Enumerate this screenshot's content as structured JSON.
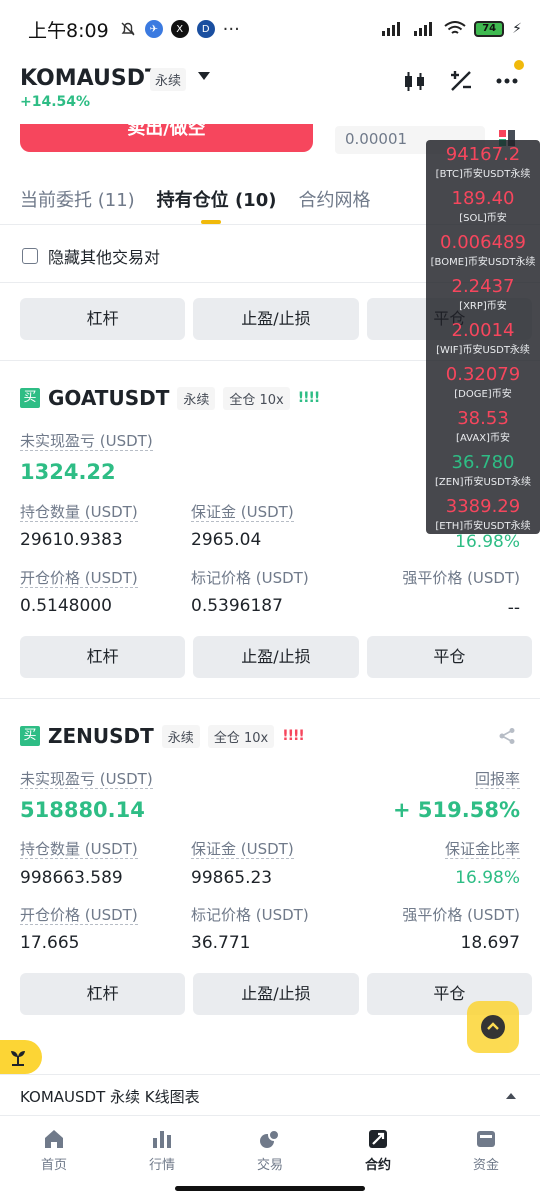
{
  "status": {
    "time": "上午8:09",
    "battery": "74"
  },
  "header": {
    "pair": "KOMAUSDT",
    "contract_type": "永续",
    "change": "+14.54%"
  },
  "order": {
    "sell_label": "卖出/做空",
    "qty_placeholder": "0.00001"
  },
  "tabs": [
    {
      "label": "当前委托 (11)"
    },
    {
      "label": "持有仓位 (10)"
    },
    {
      "label": "合约网格"
    }
  ],
  "hide_other_pairs": "隐藏其他交易对",
  "buttons": {
    "leverage": "杠杆",
    "tpsl": "止盈/止损",
    "close": "平仓"
  },
  "labels": {
    "unrealized_pnl": "未实现盈亏 (USDT)",
    "roe": "回报率",
    "size": "持仓数量 (USDT)",
    "margin": "保证金 (USDT)",
    "margin_ratio": "保证金比率",
    "entry_price": "开仓价格 (USDT)",
    "mark_price": "标记价格 (USDT)",
    "liq_price": "强平价格 (USDT)"
  },
  "positions": [
    {
      "side": "买",
      "symbol": "GOATUSDT",
      "type": "永续",
      "mode": "全仓 10x",
      "risk_bars": "!!!!",
      "risk_color": "#2ebd85",
      "pnl": "1324.22",
      "size": "29610.9383",
      "margin": "2965.04",
      "margin_ratio": "16.98%",
      "entry": "0.5148000",
      "mark": "0.5396187",
      "liq": "--"
    },
    {
      "side": "买",
      "symbol": "ZENUSDT",
      "type": "永续",
      "mode": "全仓 10x",
      "risk_bars": "!!!!",
      "risk_color": "#f6465d",
      "pnl": "518880.14",
      "roe": "+ 519.58%",
      "size": "998663.589",
      "margin": "99865.23",
      "margin_ratio": "16.98%",
      "entry": "17.665",
      "mark": "36.771",
      "liq": "18.697"
    }
  ],
  "ticker_overlay": [
    {
      "price": "94167.2",
      "name": "[BTC]币安USDT永续",
      "dir": "down"
    },
    {
      "price": "189.40",
      "name": "[SOL]币安",
      "dir": "down"
    },
    {
      "price": "0.006489",
      "name": "[BOME]币安USDT永续",
      "dir": "down"
    },
    {
      "price": "2.2437",
      "name": "[XRP]币安",
      "dir": "down"
    },
    {
      "price": "2.0014",
      "name": "[WIF]币安USDT永续",
      "dir": "down"
    },
    {
      "price": "0.32079",
      "name": "[DOGE]币安",
      "dir": "down"
    },
    {
      "price": "38.53",
      "name": "[AVAX]币安",
      "dir": "down"
    },
    {
      "price": "36.780",
      "name": "[ZEN]币安USDT永续",
      "dir": "up"
    },
    {
      "price": "3389.29",
      "name": "[ETH]币安USDT永续",
      "dir": "down"
    }
  ],
  "chart_bar": "KOMAUSDT 永续 K线图表",
  "bottom_nav": [
    {
      "label": "首页",
      "icon": "home-icon"
    },
    {
      "label": "行情",
      "icon": "markets-icon"
    },
    {
      "label": "交易",
      "icon": "trade-icon"
    },
    {
      "label": "合约",
      "icon": "futures-icon"
    },
    {
      "label": "资金",
      "icon": "wallet-icon"
    }
  ]
}
